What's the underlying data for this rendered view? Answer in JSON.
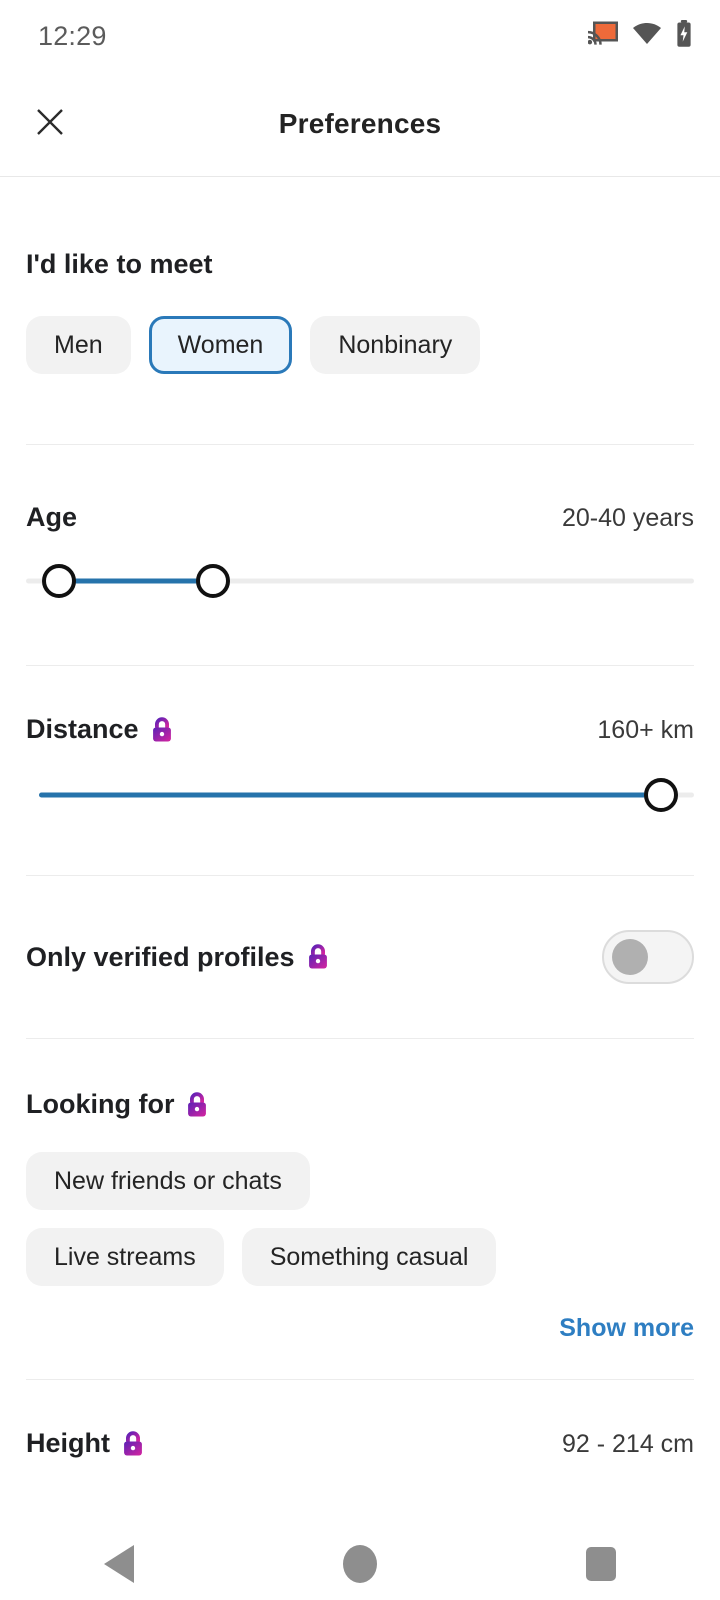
{
  "status_bar": {
    "time": "12:29",
    "icons": [
      "cast-icon",
      "wifi-icon",
      "battery-charging-icon"
    ],
    "cast_color": "#ee6a3a",
    "icon_color": "#555555"
  },
  "header": {
    "close_icon": "close-icon",
    "title": "Preferences"
  },
  "theme": {
    "accent_blue": "#2673ab",
    "link_blue": "#2e7ec2",
    "selected_chip_border": "#2a79b9",
    "selected_chip_bg": "#e9f4fd",
    "chip_bg": "#f2f2f2",
    "lock_gradient_start": "#5b21b6",
    "lock_gradient_end": "#d6249f",
    "divider": "#ececec"
  },
  "sections": {
    "meet": {
      "title": "I'd like to meet",
      "options": [
        {
          "label": "Men",
          "selected": false
        },
        {
          "label": "Women",
          "selected": true
        },
        {
          "label": "Nonbinary",
          "selected": false
        }
      ]
    },
    "age": {
      "title": "Age",
      "value": "20-40 years",
      "locked": false,
      "min_percent": 5,
      "max_percent": 28
    },
    "distance": {
      "title": "Distance",
      "value": "160+ km",
      "locked": true,
      "lock_icon": "lock-icon",
      "fill_percent": 95
    },
    "verified": {
      "title": "Only verified profiles",
      "locked": true,
      "lock_icon": "lock-icon",
      "toggle_on": false
    },
    "looking_for": {
      "title": "Looking for",
      "locked": true,
      "lock_icon": "lock-icon",
      "options": [
        {
          "label": "New friends or chats"
        },
        {
          "label": "Live streams"
        },
        {
          "label": "Something casual"
        }
      ],
      "show_more_label": "Show more"
    },
    "height": {
      "title": "Height",
      "value": "92 - 214 cm",
      "locked": true,
      "lock_icon": "lock-icon"
    }
  },
  "nav_bar": {
    "back": "back-triangle-icon",
    "home": "home-circle-icon",
    "recents": "recents-square-icon"
  }
}
